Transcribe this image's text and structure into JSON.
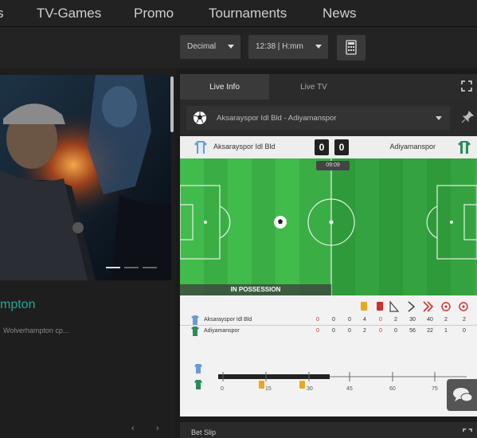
{
  "nav": {
    "items": [
      "s",
      "TV-Games",
      "Promo",
      "Tournaments",
      "News"
    ]
  },
  "toolbar": {
    "odds_format": "Decimal",
    "time_format": "12:38 | H:mm"
  },
  "promo": {
    "title": "mpton",
    "description": "Wolverhampton cp...",
    "prev": "‹",
    "next": "›"
  },
  "match": {
    "tabs": [
      "Live Info",
      "Live TV"
    ],
    "selector_text": "Aksarayspor Idl Bld - Adiyamanspor",
    "home_team": "Aksarayspor Idl Bld",
    "away_team": "Adiyamanspor",
    "home_score": "0",
    "away_score": "0",
    "time": "09:09",
    "possession_label": "IN POSSESSION"
  },
  "stats": {
    "home_team": "Aksarayspor Idl Bld",
    "away_team": "Adiyamanspor",
    "home_values": [
      "0",
      "0",
      "0",
      "4",
      "0",
      "2",
      "30",
      "40",
      "2",
      "2"
    ],
    "away_values": [
      "0",
      "0",
      "0",
      "2",
      "0",
      "0",
      "56",
      "22",
      "1",
      "0"
    ],
    "timeline_ticks": [
      "0",
      "15",
      "30",
      "45",
      "60",
      "75"
    ]
  },
  "betslip": {
    "label": "Bet Slip"
  },
  "colors": {
    "pitch_light": "#3fb84a",
    "pitch_dark": "#35a83f",
    "accent_teal": "#22a7a0"
  }
}
